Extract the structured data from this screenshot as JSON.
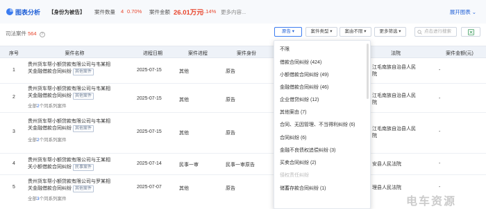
{
  "header": {
    "title": "图表分析",
    "role": "【身份为被告】",
    "count_label": "案件数量",
    "count_value": "4",
    "count_pct": "0.70%",
    "amount_label": "案件金额",
    "amount_value": "26.01万元",
    "amount_pct": "1.14%",
    "more": "更多内容...",
    "expand": "展开图表"
  },
  "filters": {
    "total_label": "司法案件",
    "total_num": "564",
    "role_btn": "原告",
    "type_btn": "案件类型",
    "reason_btn": "案由不限",
    "more_btn": "更多筛选",
    "search_placeholder": "点击进行搜索"
  },
  "table": {
    "headers": [
      "序号",
      "案件名称",
      "进程日期",
      "案件进程",
      "案件身份",
      "法院",
      "案件金额(元)"
    ],
    "rows": [
      {
        "idx": "1",
        "name1": "贵州货车帮小额贷款有限公司与韦某相",
        "name2": "关金融借款合同纠纷",
        "tag": "其他案件",
        "date": "2025-07-15",
        "stage": "其他",
        "role": "原告",
        "court1": "江毛南族自治县人民",
        "court2": "院",
        "amount": "-",
        "sub_pre": "",
        "sub_link": "",
        "sub_post": ""
      },
      {
        "idx": "2",
        "name1": "贵州货车帮小额贷款有限公司与韦某相",
        "name2": "关金融借款合同纠纷",
        "tag": "其他案件",
        "date": "2025-07-15",
        "stage": "其他",
        "role": "原告",
        "court1": "江毛南族自治县人民",
        "court2": "院",
        "amount": "-",
        "sub_pre": "全部",
        "sub_link": "2",
        "sub_post": "个同系列案件"
      },
      {
        "idx": "3",
        "name1": "贵州货车帮小额贷款有限公司与韦某相",
        "name2": "关金融借款合同纠纷",
        "tag": "其他案件",
        "date": "2025-07-15",
        "stage": "其他",
        "role": "原告",
        "court1": "江毛南族自治县人民",
        "court2": "院",
        "amount": "-",
        "sub_pre": "全部",
        "sub_link": "2",
        "sub_post": "个同系列案件"
      },
      {
        "idx": "4",
        "name1": "贵州货车帮小额贷款有限公司与王某相",
        "name2": "关小额借款合同纠纷",
        "tag": "民事案件",
        "date": "2025-07-14",
        "stage": "民事一审",
        "role": "民事一审原告",
        "court1": "安县人民法院",
        "court2": "",
        "amount": "-",
        "sub_pre": "",
        "sub_link": "",
        "sub_post": ""
      },
      {
        "idx": "5",
        "name1": "贵州货车帮小额贷款有限公司与罗某相",
        "name2": "关金融借款合同纠纷",
        "tag": "其他案件",
        "date": "2025-07-07",
        "stage": "其他",
        "role": "原告",
        "court1": "理县人民法院",
        "court2": "",
        "amount": "-",
        "sub_pre": "全部",
        "sub_link": "3",
        "sub_post": "个同系列案件"
      }
    ]
  },
  "dropdown": {
    "items": [
      {
        "label": "不限",
        "disabled": false
      },
      {
        "label": "借款合同纠纷 (424)",
        "disabled": false
      },
      {
        "label": "小额借款合同纠纷 (49)",
        "disabled": false
      },
      {
        "label": "金融借款合同纠纷 (46)",
        "disabled": false
      },
      {
        "label": "企业借贷纠纷 (12)",
        "disabled": false
      },
      {
        "label": "其他案由 (7)",
        "disabled": false
      },
      {
        "label": "合同、无因管理、不当得利纠纷 (6)",
        "disabled": false
      },
      {
        "label": "合同纠纷 (6)",
        "disabled": false
      },
      {
        "label": "金融不良债权追偿纠纷 (3)",
        "disabled": false
      },
      {
        "label": "买卖合同纠纷 (2)",
        "disabled": false
      },
      {
        "label": "侵权责任纠纷",
        "disabled": true
      },
      {
        "label": "储蓄存款合同纠纷 (1)",
        "disabled": false
      }
    ]
  },
  "watermark": "电车资源",
  "colors": {
    "accent": "#1f5fd6",
    "highlight": "#e8452c",
    "header_bg": "#eef2f8"
  }
}
